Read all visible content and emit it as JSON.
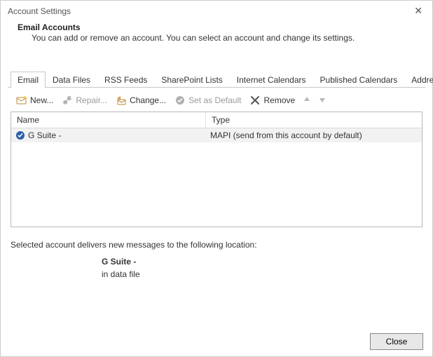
{
  "window": {
    "title": "Account Settings"
  },
  "header": {
    "title": "Email Accounts",
    "subtitle": "You can add or remove an account. You can select an account and change its settings."
  },
  "tabs": [
    {
      "label": "Email"
    },
    {
      "label": "Data Files"
    },
    {
      "label": "RSS Feeds"
    },
    {
      "label": "SharePoint Lists"
    },
    {
      "label": "Internet Calendars"
    },
    {
      "label": "Published Calendars"
    },
    {
      "label": "Address Books"
    }
  ],
  "toolbar": {
    "new_label": "New...",
    "repair_label": "Repair...",
    "change_label": "Change...",
    "default_label": "Set as Default",
    "remove_label": "Remove"
  },
  "list": {
    "col_name": "Name",
    "col_type": "Type",
    "rows": [
      {
        "name": "G Suite -",
        "type": "MAPI (send from this account by default)"
      }
    ]
  },
  "delivery": {
    "intro": "Selected account delivers new messages to the following location:",
    "line1": "G Suite -",
    "line2": "in data file"
  },
  "footer": {
    "close_label": "Close"
  }
}
